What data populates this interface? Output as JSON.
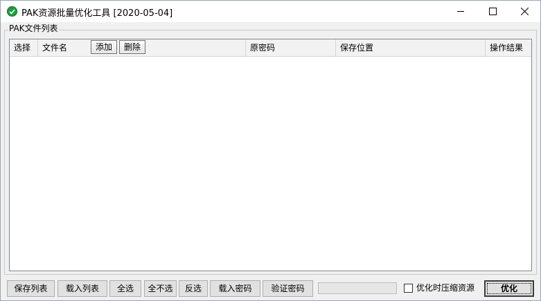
{
  "window": {
    "title": "PAK资源批量优化工具 [2020-05-04]",
    "app_icon": "green-check-circle-icon",
    "controls": [
      "minimize-icon",
      "maximize-icon",
      "close-icon"
    ]
  },
  "group": {
    "label": "PAK文件列表"
  },
  "list": {
    "columns": [
      "选择",
      "文件名",
      "原密码",
      "保存位置",
      "操作结果"
    ],
    "header_buttons": {
      "add": "添加",
      "delete": "删除"
    },
    "rows": []
  },
  "bottom": {
    "save_list": "保存列表",
    "load_list": "载入列表",
    "select_all": "全选",
    "select_none": "全不选",
    "invert": "反选",
    "load_password": "载入密码",
    "verify_password": "验证密码",
    "progress": 0,
    "compress_checkbox_label": "优化时压缩资源",
    "compress_checked": false,
    "optimize": "优化"
  },
  "colors": {
    "window_bg": "#f0f0f0",
    "titlebar_bg": "#ffffff",
    "list_bg": "#ffffff",
    "icon_green": "#1e9e40"
  }
}
